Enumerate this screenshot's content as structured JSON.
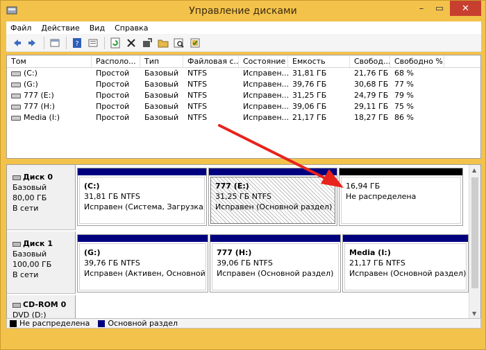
{
  "window": {
    "title": "Управление дисками",
    "minimize": "–",
    "maximize": "▭",
    "close": "✕"
  },
  "menu": [
    "Файл",
    "Действие",
    "Вид",
    "Справка"
  ],
  "toolbar": {
    "icons": [
      "back-arrow-icon",
      "forward-arrow-icon",
      "console-icon",
      "help-icon",
      "properties-icon",
      "refresh-icon",
      "delete-icon",
      "settings-icon",
      "open-folder-icon",
      "find-icon",
      "check-icon"
    ]
  },
  "volumes": {
    "columns": [
      "Том",
      "Располо...",
      "Тип",
      "Файловая с...",
      "Состояние",
      "Емкость",
      "Свобод...",
      "Свободно %"
    ],
    "rows": [
      [
        "(C:)",
        "Простой",
        "Базовый",
        "NTFS",
        "Исправен...",
        "31,81 ГБ",
        "21,76 ГБ",
        "68 %"
      ],
      [
        "(G:)",
        "Простой",
        "Базовый",
        "NTFS",
        "Исправен...",
        "39,76 ГБ",
        "30,68 ГБ",
        "77 %"
      ],
      [
        "777 (E:)",
        "Простой",
        "Базовый",
        "NTFS",
        "Исправен...",
        "31,25 ГБ",
        "24,79 ГБ",
        "79 %"
      ],
      [
        "777 (H:)",
        "Простой",
        "Базовый",
        "NTFS",
        "Исправен...",
        "39,06 ГБ",
        "29,11 ГБ",
        "75 %"
      ],
      [
        "Media (I:)",
        "Простой",
        "Базовый",
        "NTFS",
        "Исправен...",
        "21,17 ГБ",
        "18,27 ГБ",
        "86 %"
      ]
    ]
  },
  "disks": {
    "disk0": {
      "name": "Диск 0",
      "type": "Базовый",
      "size": "80,00 ГБ",
      "status": "В сети",
      "parts": [
        {
          "name": "(C:)",
          "size": "31,81 ГБ NTFS",
          "status": "Исправен (Система, Загрузка, Фай"
        },
        {
          "name": "777  (E:)",
          "size": "31,25 ГБ NTFS",
          "status": "Исправен (Основной раздел)"
        },
        {
          "name": "",
          "size": "16,94 ГБ",
          "status": "Не распределена"
        }
      ]
    },
    "disk1": {
      "name": "Диск 1",
      "type": "Базовый",
      "size": "100,00 ГБ",
      "status": "В сети",
      "parts": [
        {
          "name": "(G:)",
          "size": "39,76 ГБ NTFS",
          "status": "Исправен (Активен, Основной раздел"
        },
        {
          "name": "777  (H:)",
          "size": "39,06 ГБ NTFS",
          "status": "Исправен (Основной раздел)"
        },
        {
          "name": "Media  (I:)",
          "size": "21,17 ГБ NTFS",
          "status": "Исправен (Основной раздел)"
        }
      ]
    },
    "cdrom0": {
      "name": "CD-ROM 0",
      "type": "DVD (D:)"
    }
  },
  "legend": {
    "unallocated": "Не распределена",
    "primary": "Основной раздел"
  },
  "colors": {
    "primary": "#00007f",
    "unallocated": "#000000",
    "arrow": "#e8231c"
  }
}
